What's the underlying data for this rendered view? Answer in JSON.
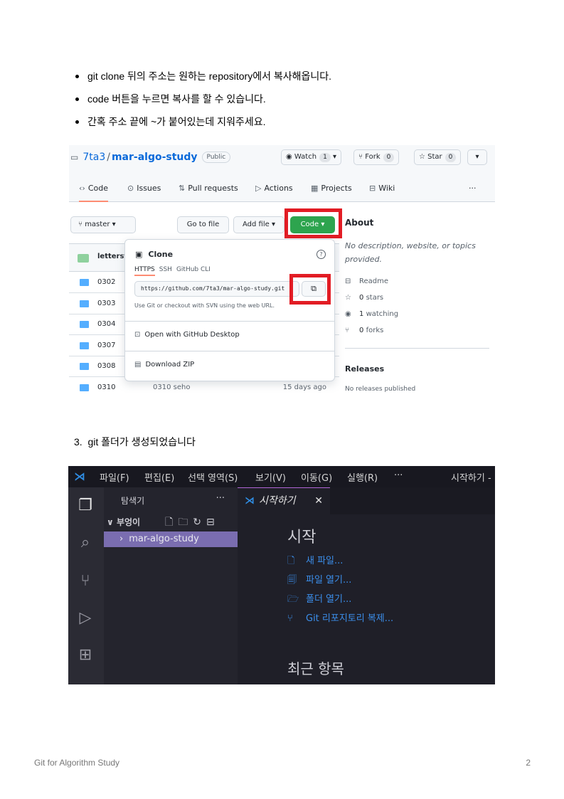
{
  "bullets": [
    "git clone 뒤의 주소는 원하는 repository에서 복사해옵니다.",
    "code 버튼을 누르면 복사를 할 수 있습니다.",
    "간혹 주소 끝에 ~가 붙어있는데 지워주세요."
  ],
  "github": {
    "owner": "7ta3",
    "repo": "mar-algo-study",
    "visibility": "Public",
    "watch_label": "Watch",
    "watch_count": "1",
    "fork_label": "Fork",
    "fork_count": "0",
    "star_label": "Star",
    "star_count": "0",
    "tabs": [
      "Code",
      "Issues",
      "Pull requests",
      "Actions",
      "Projects",
      "Wiki",
      "···"
    ],
    "branch": "master",
    "go_to_file": "Go to file",
    "add_file": "Add file",
    "code_button": "Code",
    "commit_author": "letterst",
    "files": [
      {
        "name": "0302",
        "commit": "",
        "time": ""
      },
      {
        "name": "0303",
        "commit": "",
        "time": ""
      },
      {
        "name": "0304",
        "commit": "",
        "time": ""
      },
      {
        "name": "0307",
        "commit": "",
        "time": ""
      },
      {
        "name": "0308",
        "commit": "",
        "time": ""
      },
      {
        "name": "0310",
        "commit": "0310 seho",
        "time": "15 days ago"
      }
    ],
    "clone": {
      "title": "Clone",
      "tabs": [
        "HTTPS",
        "SSH",
        "GitHub CLI"
      ],
      "url": "https://github.com/7ta3/mar-algo-study.git",
      "help": "Use Git or checkout with SVN using the web URL.",
      "open_desktop": "Open with GitHub Desktop",
      "download_zip": "Download ZIP"
    },
    "about": {
      "heading": "About",
      "description": "No description, website, or topics provided.",
      "readme": "Readme",
      "stars_count": "0",
      "stars_label": "stars",
      "watching_count": "1",
      "watching_label": "watching",
      "forks_count": "0",
      "forks_label": "forks"
    },
    "releases": {
      "heading": "Releases",
      "text": "No releases published"
    }
  },
  "step3": {
    "number": "3.",
    "text": "git 폴더가 생성되었습니다"
  },
  "vscode": {
    "menu": [
      "파일(F)",
      "편집(E)",
      "선택 영역(S)",
      "보기(V)",
      "이동(G)",
      "실행(R)",
      "···"
    ],
    "window_title": "시작하기 -",
    "explorer_title": "탐색기",
    "explorer_more": "···",
    "workspace": "부엉이",
    "folder": "mar-algo-study",
    "tab_title": "시작하기",
    "start_heading": "시작",
    "start_links": [
      "새 파일...",
      "파일 열기...",
      "폴더 열기...",
      "Git 리포지토리 복제..."
    ],
    "recent_heading": "최근 항목"
  },
  "footer": {
    "title": "Git for Algorithm Study",
    "page": "2"
  }
}
